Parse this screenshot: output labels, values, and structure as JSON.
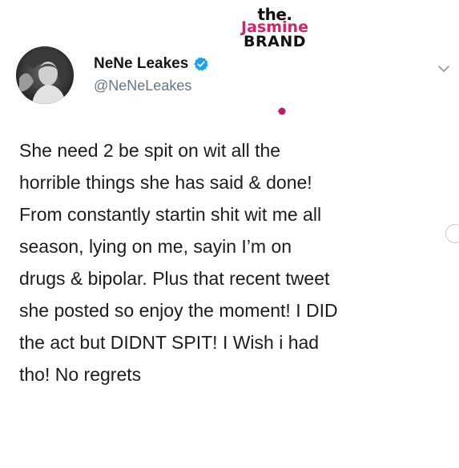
{
  "watermark": {
    "the": "the.",
    "jasmine": "Jasmine",
    "brand": "BRAND"
  },
  "tweet": {
    "display_name": "NeNe Leakes",
    "handle": "@NeNeLeakes",
    "text": "She need 2 be spit on wit all the\nhorrible things she has said & done!\nFrom constantly startin shit wit me all\nseason, lying on me, sayin I’m on\ndrugs & bipolar. Plus that recent tweet\nshe posted so enjoy the moment! I DID\nthe act but DIDNT SPIT! I Wish i had\ntho! No regrets"
  },
  "colors": {
    "verified": "#1da1f2",
    "brand_pink": "#d6226b",
    "handle_gray": "#657786",
    "dot": "#c0196b"
  },
  "icons": {
    "verified": "verified-badge-icon",
    "caret": "chevron-down-icon"
  }
}
